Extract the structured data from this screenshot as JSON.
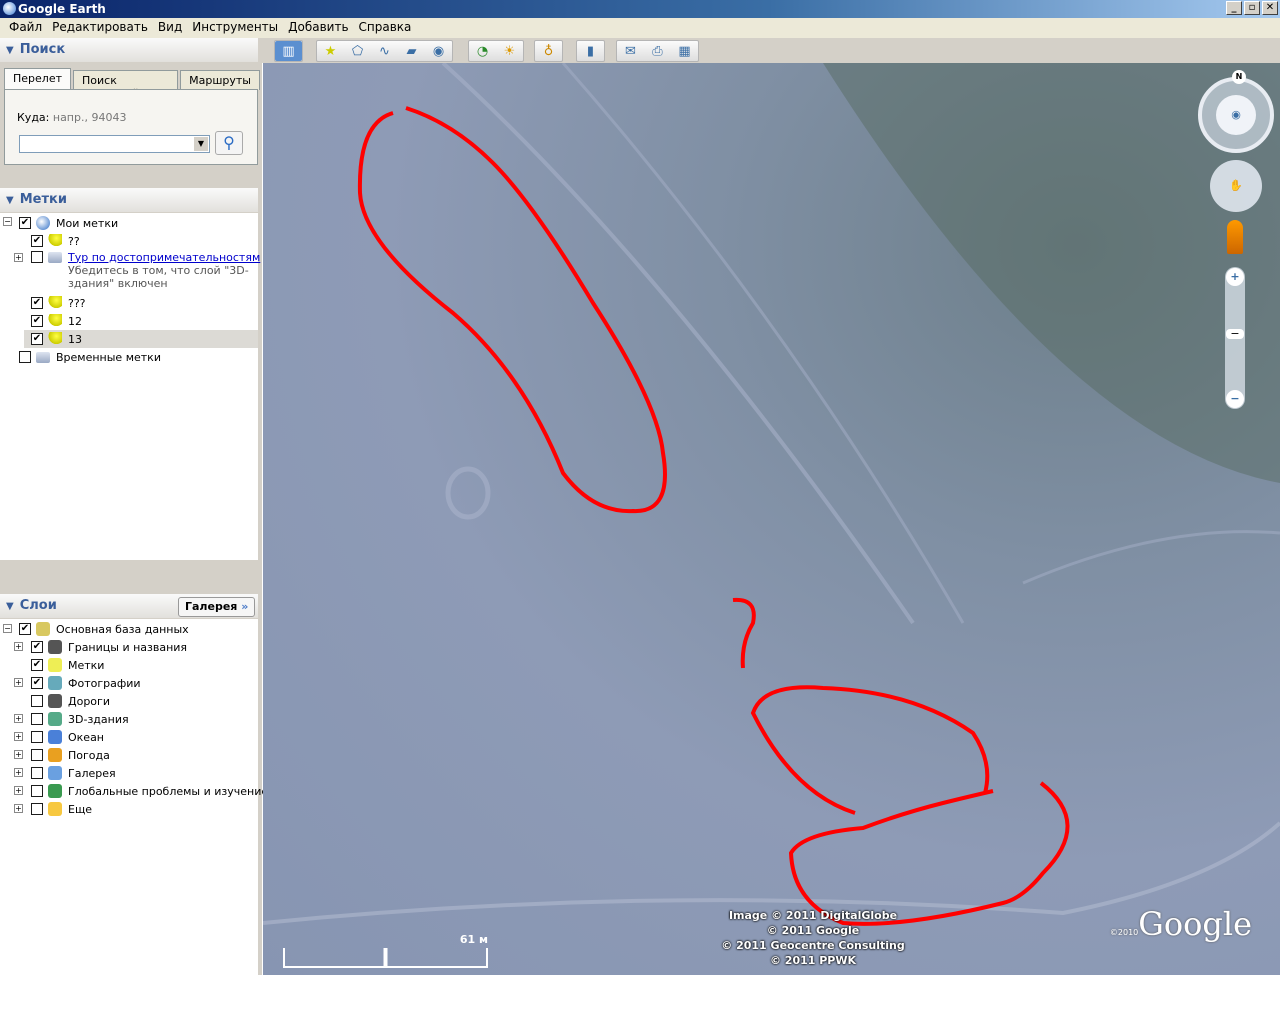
{
  "window": {
    "title": "Google Earth",
    "controls": [
      "_",
      "▫",
      "✕"
    ]
  },
  "menu": [
    "Файл",
    "Редактировать",
    "Вид",
    "Инструменты",
    "Добавить",
    "Справка"
  ],
  "search": {
    "header": "Поиск",
    "tabs": [
      "Перелет",
      "Поиск компаний",
      "Маршруты"
    ],
    "fly_label": "Куда:",
    "fly_hint": "напр., 94043",
    "input_value": ""
  },
  "places": {
    "header": "Метки",
    "items": [
      {
        "label": "Мои метки",
        "checked": true
      },
      {
        "label": "??",
        "checked": true
      },
      {
        "label": "Тур по достопримечательностям",
        "checked": false,
        "desc1": "Убедитесь в том, что слой \"3D-",
        "desc2": "здания\" включен"
      },
      {
        "label": "???",
        "checked": true
      },
      {
        "label": "12",
        "checked": true
      },
      {
        "label": "13",
        "checked": true
      },
      {
        "label": "Временные метки",
        "checked": false
      }
    ]
  },
  "layers": {
    "header": "Слои",
    "gallery_button": "Галерея",
    "items": [
      {
        "label": "Основная база данных",
        "checked": true
      },
      {
        "label": "Границы и названия",
        "checked": true
      },
      {
        "label": "Метки",
        "checked": true
      },
      {
        "label": "Фотографии",
        "checked": true
      },
      {
        "label": "Дороги",
        "checked": false
      },
      {
        "label": "3D-здания",
        "checked": false
      },
      {
        "label": "Океан",
        "checked": false
      },
      {
        "label": "Погода",
        "checked": false
      },
      {
        "label": "Галерея",
        "checked": false
      },
      {
        "label": "Глобальные проблемы и изучение ...",
        "checked": false
      },
      {
        "label": "Еще",
        "checked": false
      }
    ]
  },
  "map": {
    "attribution": [
      "Image © 2011 DigitalGlobe",
      "© 2011 Google",
      "© 2011 Geocentre Consulting",
      "© 2011 PPWK"
    ],
    "logo": "Google",
    "logo_year": "©2010",
    "scale": "61 м",
    "compass_north": "N",
    "annotation_color": "#ff0000"
  }
}
